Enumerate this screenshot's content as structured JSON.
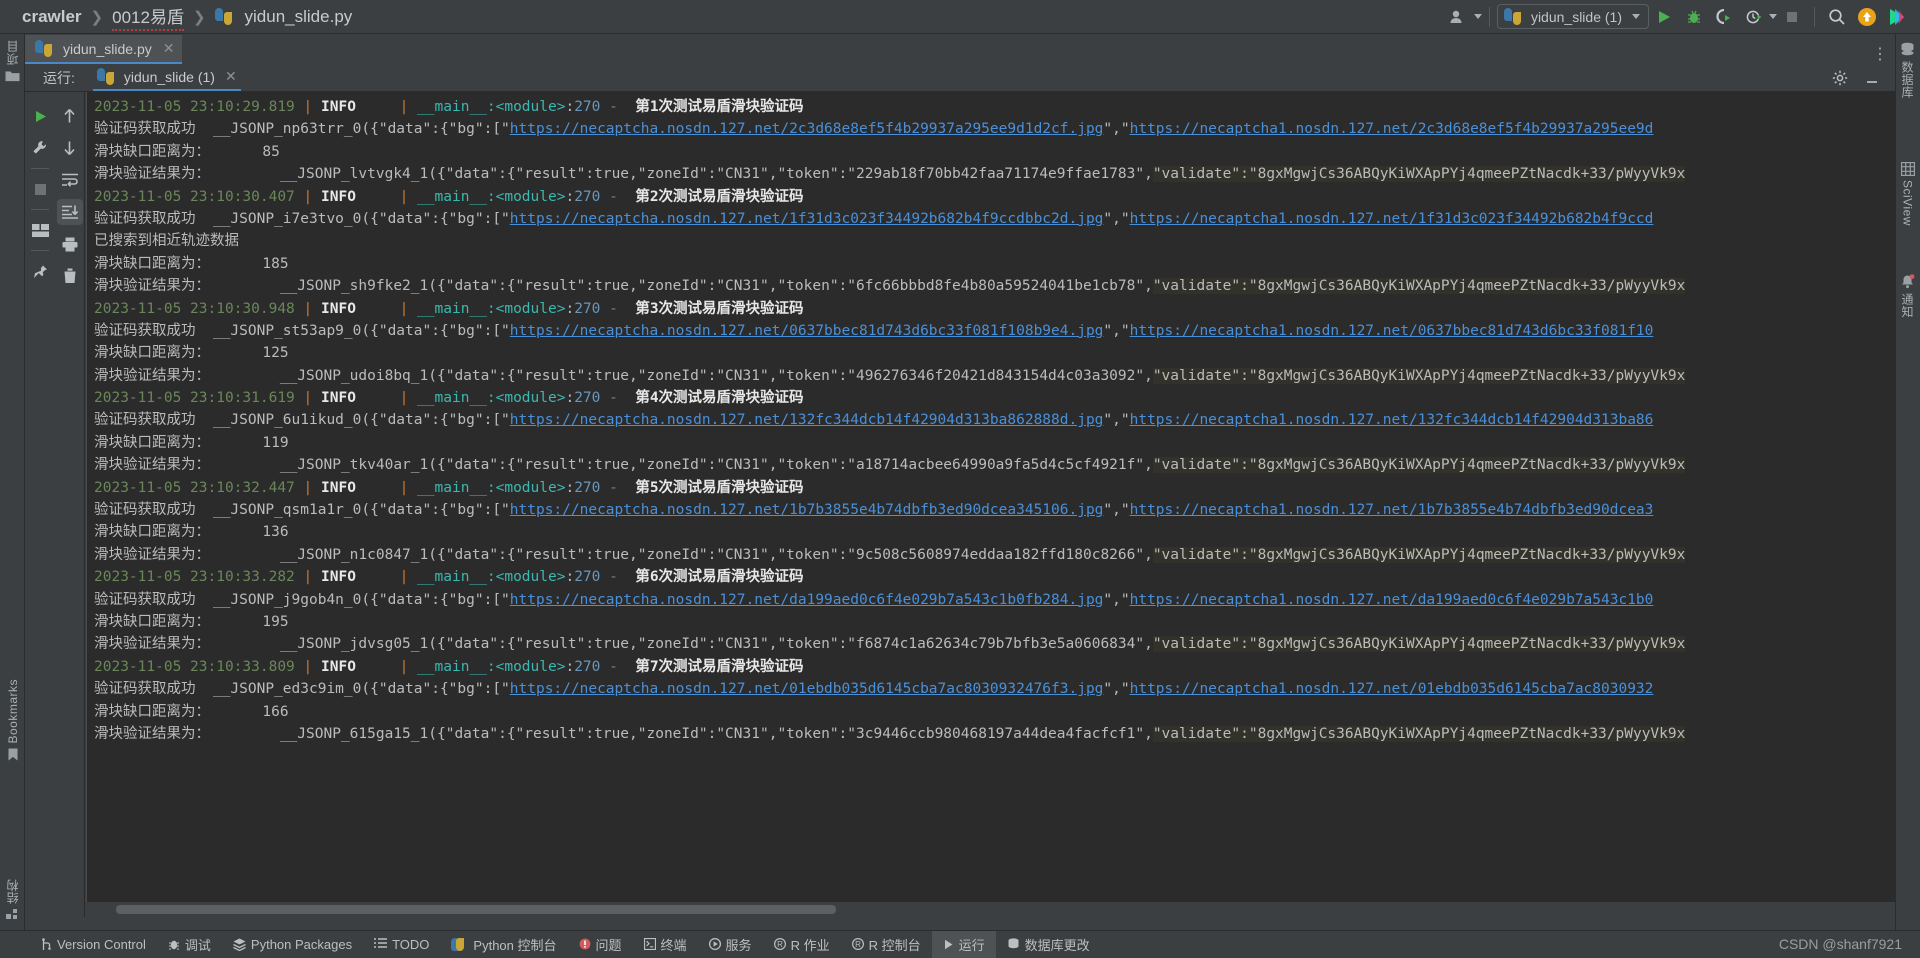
{
  "breadcrumb": {
    "root": "crawler",
    "middle": "0012易盾",
    "file": "yidun_slide.py",
    "separator": "❯"
  },
  "toolbar": {
    "run_config_label": "yidun_slide (1)",
    "icons": [
      "user-group-icon",
      "run-icon",
      "debug-icon",
      "run-coverage-icon",
      "profile-icon",
      "stop-icon",
      "search-icon",
      "update-icon",
      "ide-logo-icon"
    ]
  },
  "editor_tab": {
    "label": "yidun_slide.py",
    "close": "✕"
  },
  "run_window": {
    "title": "运行:",
    "tab_label": "yidun_slide (1)",
    "tab_close": "✕",
    "settings_icon": "gear-icon",
    "minimize_icon": "minimize-icon"
  },
  "left_stripe": {
    "project_label": "项目",
    "bookmarks_label": "Bookmarks",
    "structure_label": "结构"
  },
  "right_stripe": {
    "database_label": "数据库",
    "sciview_label": "SciView",
    "notifications_label": "通知"
  },
  "run_toolbar_a": [
    "rerun-icon",
    "settings-wrench-icon",
    "stop-icon",
    "layout-icon",
    "pin-icon"
  ],
  "run_toolbar_b": [
    "up-arrow-icon",
    "down-arrow-icon",
    "soft-wrap-icon",
    "scroll-to-end-icon",
    "print-icon",
    "trash-icon"
  ],
  "console": {
    "log_prefix_pipe": "|",
    "level": "INFO",
    "module": "__main__:<module>",
    "line_no": "270",
    "dash": "-",
    "label_captcha_ok": "验证码获取成功",
    "label_gap": "滑块缺口距离为：",
    "label_result": "滑块验证结果为：",
    "label_track_found": "已搜索到相近轨迹数据",
    "validate_value": "\"validate\":\"8gxMgwjCs36ABQyKiWXApPYj4qmeePZtNacdk+33/pWyyVk9x",
    "entries": [
      {
        "timestamp": "2023-11-05 23:10:29.819",
        "message": "第1次测试易盾滑块验证码",
        "jsonp_bg": "__JSONP_np63trr_0({\"data\":{\"bg\":[\"",
        "bg_url": "https://necaptcha.nosdn.127.net/2c3d68e8ef5f4b29937a295ee9d1d2cf.jpg",
        "bg_url2": "https://necaptcha1.nosdn.127.net/2c3d68e8ef5f4b29937a295ee9d",
        "gap": "85",
        "track_found": false,
        "jsonp_result": "__JSONP_lvtvgk4_1({\"data\":{\"result\":true,\"zoneId\":\"CN31\",\"token\":\"229ab18f70bb42faa71174e9ffae1783\","
      },
      {
        "timestamp": "2023-11-05 23:10:30.407",
        "message": "第2次测试易盾滑块验证码",
        "jsonp_bg": "__JSONP_i7e3tvo_0({\"data\":{\"bg\":[\"",
        "bg_url": "https://necaptcha.nosdn.127.net/1f31d3c023f34492b682b4f9ccdbbc2d.jpg",
        "bg_url2": "https://necaptcha1.nosdn.127.net/1f31d3c023f34492b682b4f9ccd",
        "gap": "185",
        "track_found": true,
        "jsonp_result": "__JSONP_sh9fke2_1({\"data\":{\"result\":true,\"zoneId\":\"CN31\",\"token\":\"6fc66bbbd8fe4b80a59524041be1cb78\","
      },
      {
        "timestamp": "2023-11-05 23:10:30.948",
        "message": "第3次测试易盾滑块验证码",
        "jsonp_bg": "__JSONP_st53ap9_0({\"data\":{\"bg\":[\"",
        "bg_url": "https://necaptcha.nosdn.127.net/0637bbec81d743d6bc33f081f108b9e4.jpg",
        "bg_url2": "https://necaptcha1.nosdn.127.net/0637bbec81d743d6bc33f081f10",
        "gap": "125",
        "track_found": false,
        "jsonp_result": "__JSONP_udoi8bq_1({\"data\":{\"result\":true,\"zoneId\":\"CN31\",\"token\":\"496276346f20421d843154d4c03a3092\","
      },
      {
        "timestamp": "2023-11-05 23:10:31.619",
        "message": "第4次测试易盾滑块验证码",
        "jsonp_bg": "__JSONP_6u1ikud_0({\"data\":{\"bg\":[\"",
        "bg_url": "https://necaptcha.nosdn.127.net/132fc344dcb14f42904d313ba862888d.jpg",
        "bg_url2": "https://necaptcha1.nosdn.127.net/132fc344dcb14f42904d313ba86",
        "gap": "119",
        "track_found": false,
        "jsonp_result": "__JSONP_tkv40ar_1({\"data\":{\"result\":true,\"zoneId\":\"CN31\",\"token\":\"a18714acbee64990a9fa5d4c5cf4921f\","
      },
      {
        "timestamp": "2023-11-05 23:10:32.447",
        "message": "第5次测试易盾滑块验证码",
        "jsonp_bg": "__JSONP_qsm1a1r_0({\"data\":{\"bg\":[\"",
        "bg_url": "https://necaptcha.nosdn.127.net/1b7b3855e4b74dbfb3ed90dcea345106.jpg",
        "bg_url2": "https://necaptcha1.nosdn.127.net/1b7b3855e4b74dbfb3ed90dcea3",
        "gap": "136",
        "track_found": false,
        "jsonp_result": "__JSONP_n1c0847_1({\"data\":{\"result\":true,\"zoneId\":\"CN31\",\"token\":\"9c508c5608974eddaa182ffd180c8266\","
      },
      {
        "timestamp": "2023-11-05 23:10:33.282",
        "message": "第6次测试易盾滑块验证码",
        "jsonp_bg": "__JSONP_j9gob4n_0({\"data\":{\"bg\":[\"",
        "bg_url": "https://necaptcha.nosdn.127.net/da199aed0c6f4e029b7a543c1b0fb284.jpg",
        "bg_url2": "https://necaptcha1.nosdn.127.net/da199aed0c6f4e029b7a543c1b0",
        "gap": "195",
        "track_found": false,
        "jsonp_result": "__JSONP_jdvsg05_1({\"data\":{\"result\":true,\"zoneId\":\"CN31\",\"token\":\"f6874c1a62634c79b7bfb3e5a0606834\","
      },
      {
        "timestamp": "2023-11-05 23:10:33.809",
        "message": "第7次测试易盾滑块验证码",
        "jsonp_bg": "__JSONP_ed3c9im_0({\"data\":{\"bg\":[\"",
        "bg_url": "https://necaptcha.nosdn.127.net/01ebdb035d6145cba7ac8030932476f3.jpg",
        "bg_url2": "https://necaptcha1.nosdn.127.net/01ebdb035d6145cba7ac8030932",
        "gap": "166",
        "track_found": false,
        "jsonp_result": "__JSONP_615ga15_1({\"data\":{\"result\":true,\"zoneId\":\"CN31\",\"token\":\"3c9446ccb980468197a44dea4facfcf1\","
      }
    ]
  },
  "statusbar": {
    "items": [
      {
        "label": "Version Control",
        "icon": "branch-icon",
        "active": false
      },
      {
        "label": "调试",
        "icon": "debug-icon",
        "active": false
      },
      {
        "label": "Python Packages",
        "icon": "packages-icon",
        "active": false
      },
      {
        "label": "TODO",
        "icon": "todo-icon",
        "active": false
      },
      {
        "label": "Python 控制台",
        "icon": "python-icon",
        "active": false
      },
      {
        "label": "问题",
        "icon": "problems-icon",
        "active": false
      },
      {
        "label": "终端",
        "icon": "terminal-icon",
        "active": false
      },
      {
        "label": "服务",
        "icon": "services-icon",
        "active": false
      },
      {
        "label": "R 作业",
        "icon": "r-icon",
        "active": false
      },
      {
        "label": "R 控制台",
        "icon": "r-icon",
        "active": false
      },
      {
        "label": "运行",
        "icon": "run-icon",
        "active": true
      },
      {
        "label": "数据库更改",
        "icon": "database-changes-icon",
        "active": false
      }
    ],
    "watermark": "CSDN @shanf7921"
  },
  "colors": {
    "bg_ide": "#3c3f41",
    "bg_console": "#2b2b2b",
    "accent_blue": "#4a88c7",
    "green_ts": "#6a8759",
    "orange_pipe": "#cc7832",
    "cyan_mod": "#3bb8b0",
    "link": "#4a90d9",
    "highlight": "#32322a"
  }
}
